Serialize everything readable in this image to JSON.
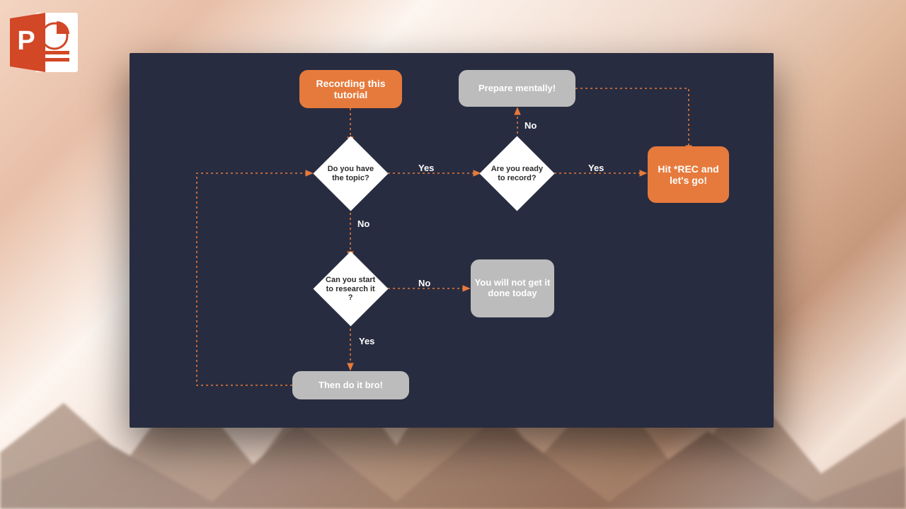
{
  "app_icon": {
    "letter": "P"
  },
  "nodes": {
    "start": {
      "text": "Recording this tutorial"
    },
    "d_topic": {
      "text": "Do you have the topic?"
    },
    "d_ready": {
      "text": "Are you ready to record?"
    },
    "d_research": {
      "text": "Can you start to research it ?"
    },
    "prepare": {
      "text": "Prepare mentally!"
    },
    "rec": {
      "text": "Hit *REC and let's go!"
    },
    "notdone": {
      "text": "You will not get it done today"
    },
    "doit": {
      "text": "Then do it bro!"
    }
  },
  "labels": {
    "topic_yes": "Yes",
    "topic_no": "No",
    "ready_yes": "Yes",
    "ready_no": "No",
    "research_no": "No",
    "research_yes": "Yes"
  },
  "colors": {
    "slide_bg": "#282c40",
    "accent": "#e67a3c",
    "neutral": "#bcbcbc",
    "connector": "#e67a3c"
  }
}
